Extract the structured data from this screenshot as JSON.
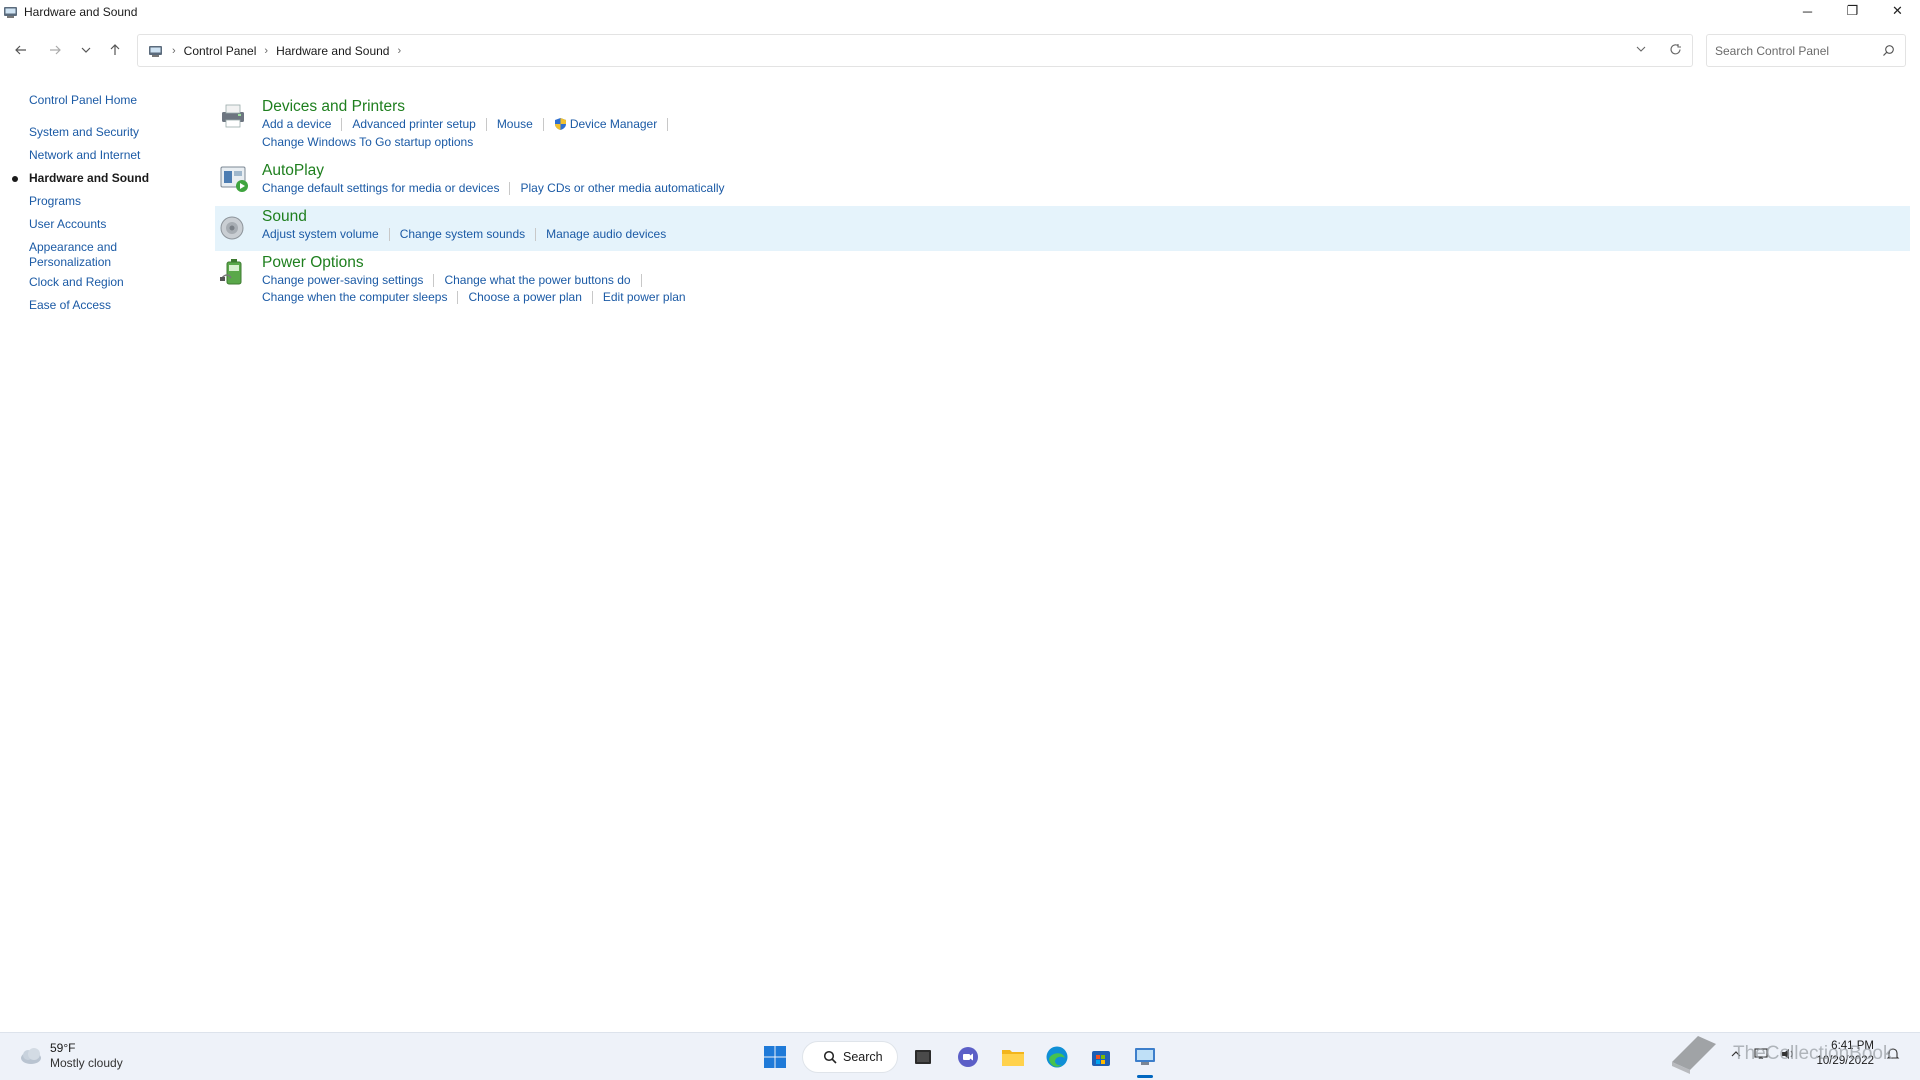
{
  "window": {
    "title": "Hardware and Sound",
    "controls": {
      "minimize": "─",
      "maximize": "❐",
      "close": "✕"
    }
  },
  "address_bar": {
    "breadcrumbs": [
      "Control Panel",
      "Hardware and Sound"
    ],
    "separator": "›"
  },
  "search": {
    "placeholder": "Search Control Panel"
  },
  "left_nav": {
    "home": "Control Panel Home",
    "items": [
      {
        "label": "System and Security",
        "active": false
      },
      {
        "label": "Network and Internet",
        "active": false
      },
      {
        "label": "Hardware and Sound",
        "active": true
      },
      {
        "label": "Programs",
        "active": false
      },
      {
        "label": "User Accounts",
        "active": false
      },
      {
        "label": "Appearance and Personalization",
        "active": false
      },
      {
        "label": "Clock and Region",
        "active": false
      },
      {
        "label": "Ease of Access",
        "active": false
      }
    ]
  },
  "categories": [
    {
      "title": "Devices and Printers",
      "icon": "printer-icon",
      "links_row1": [
        "Add a device",
        "Advanced printer setup",
        "Mouse",
        "Device Manager"
      ],
      "links_row2": [
        "Change Windows To Go startup options"
      ]
    },
    {
      "title": "AutoPlay",
      "icon": "autoplay-icon",
      "links_row1": [
        "Change default settings for media or devices",
        "Play CDs or other media automatically"
      ]
    },
    {
      "title": "Sound",
      "icon": "speaker-icon",
      "links_row1": [
        "Adjust system volume",
        "Change system sounds",
        "Manage audio devices"
      ]
    },
    {
      "title": "Power Options",
      "icon": "battery-icon",
      "links_row1": [
        "Change power-saving settings",
        "Change what the power buttons do"
      ],
      "links_row2": [
        "Change when the computer sleeps",
        "Choose a power plan",
        "Edit power plan"
      ]
    }
  ],
  "taskbar": {
    "weather": {
      "temp": "59°F",
      "condition": "Mostly cloudy"
    },
    "search_label": "Search",
    "clock": {
      "time": "6:41 PM",
      "date": "10/29/2022"
    },
    "watermark": "TheCollectionBook"
  },
  "colors": {
    "link": "#1b5aa5",
    "category_title": "#1e7f1e",
    "highlight": "#e5f3fb",
    "taskbar": "#eef2f9"
  }
}
